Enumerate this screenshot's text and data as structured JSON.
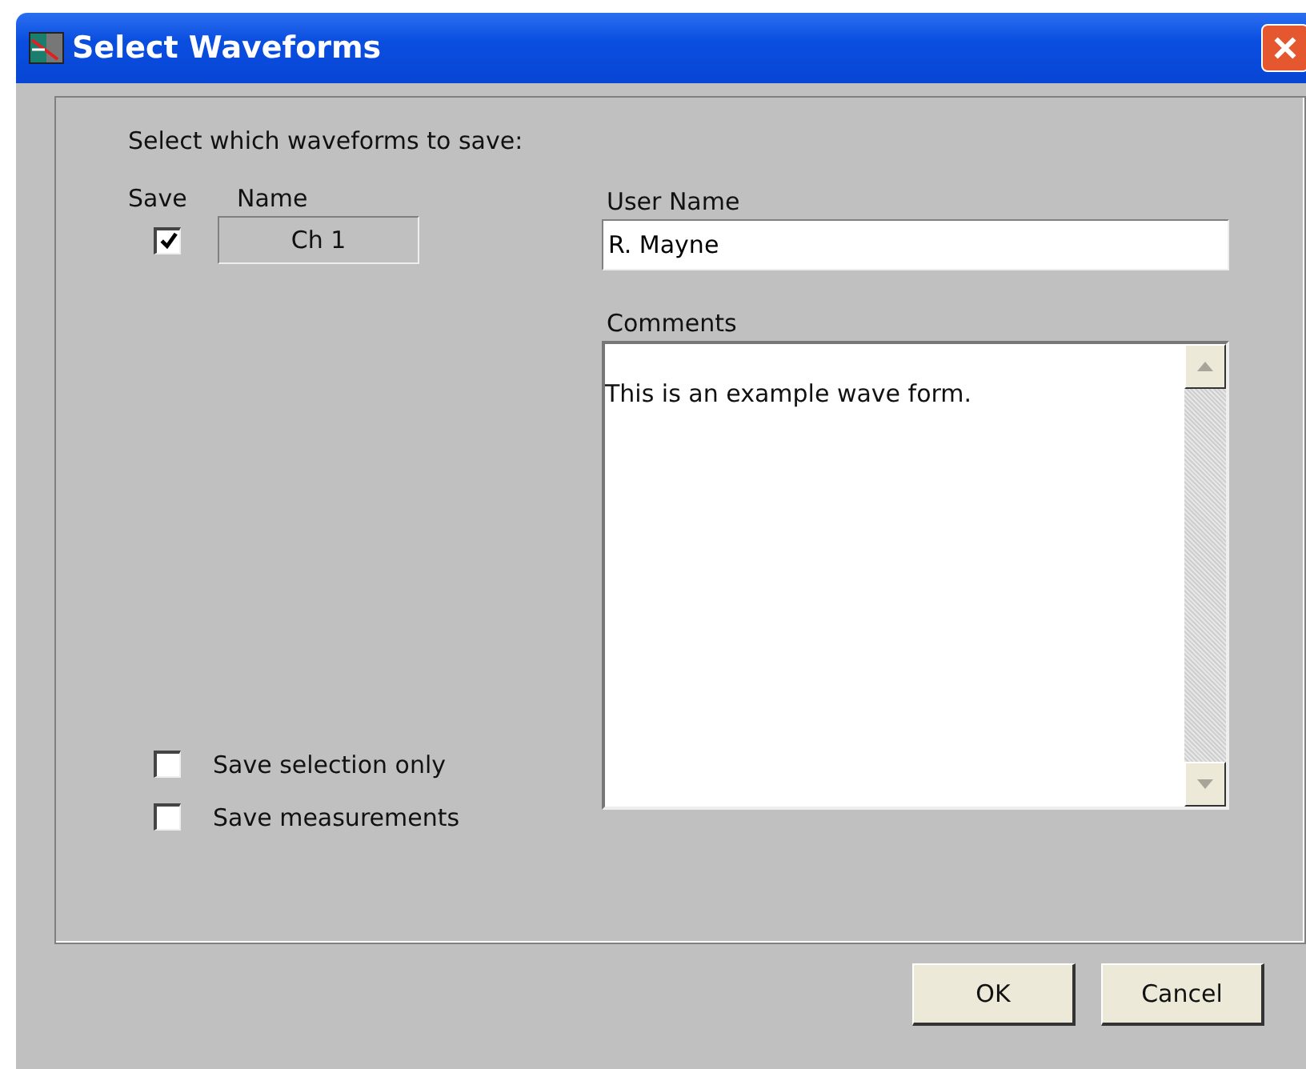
{
  "window": {
    "title": "Select Waveforms"
  },
  "prompt": "Select which waveforms to save:",
  "columns": [
    "Save",
    "Name"
  ],
  "waveforms": [
    {
      "name": "Ch 1",
      "checked": true
    }
  ],
  "user_name": {
    "label": "User Name",
    "value": "R. Mayne"
  },
  "comments": {
    "label": "Comments",
    "value": "This is an example wave form."
  },
  "options": [
    {
      "label": "Save selection only",
      "checked": false
    },
    {
      "label": "Save measurements",
      "checked": false
    }
  ],
  "buttons": [
    "OK",
    "Cancel"
  ]
}
